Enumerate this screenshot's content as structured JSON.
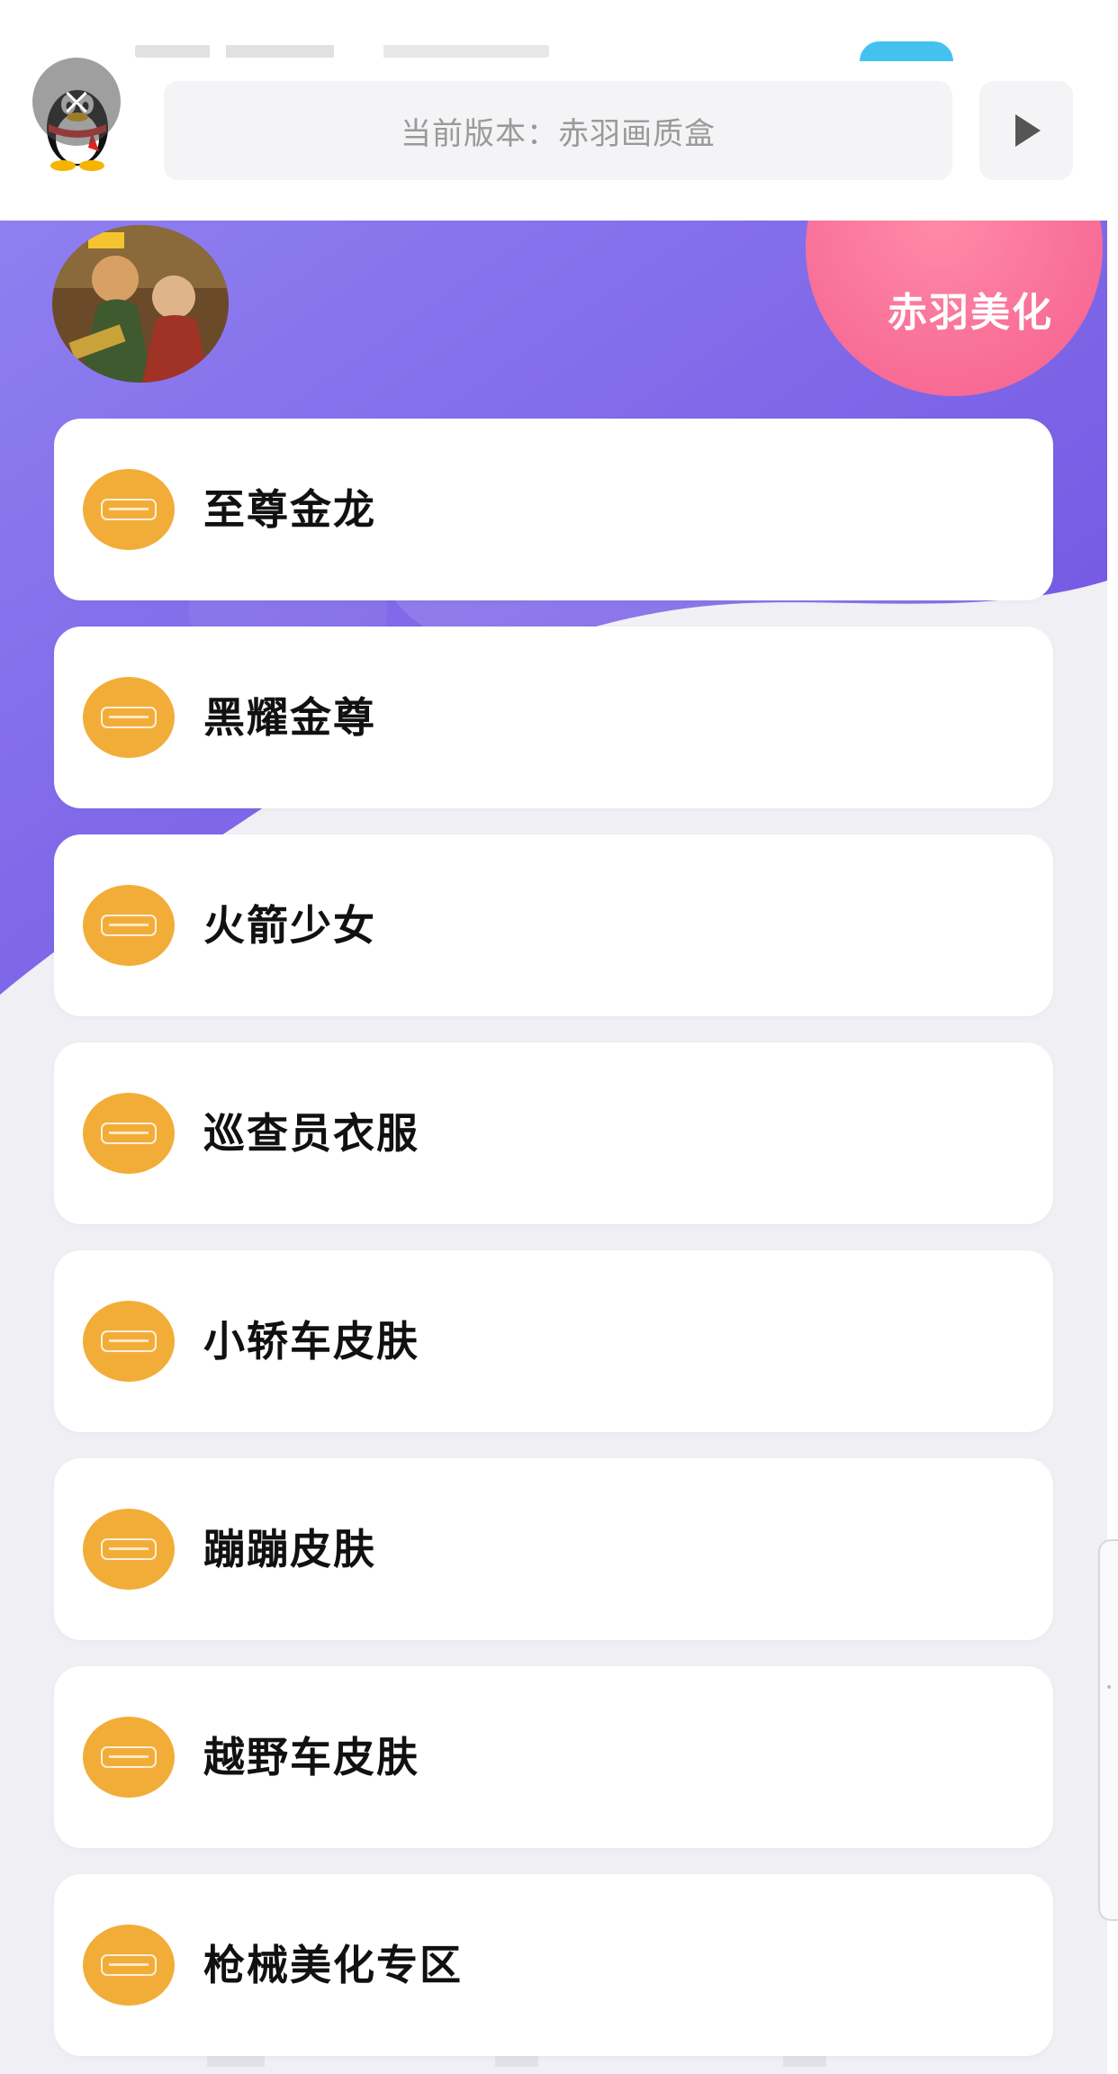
{
  "header": {
    "version_text": "当前版本：赤羽画质盒",
    "brand": "赤羽美化"
  },
  "theme": {
    "accent": "#7b62e6",
    "accent_light": "#a79af2",
    "pink": "#f96e98",
    "icon_orange": "#f2ad38",
    "panel_bg": "#efeff4"
  },
  "icons": {
    "close": "close-icon",
    "qq": "qq-penguin-icon",
    "play": "play-icon"
  },
  "menu": {
    "items": [
      {
        "label": "至尊金龙"
      },
      {
        "label": "黑耀金尊"
      },
      {
        "label": "火箭少女"
      },
      {
        "label": "巡查员衣服"
      },
      {
        "label": "小轿车皮肤"
      },
      {
        "label": "蹦蹦皮肤"
      },
      {
        "label": "越野车皮肤"
      },
      {
        "label": "枪械美化专区"
      }
    ]
  }
}
